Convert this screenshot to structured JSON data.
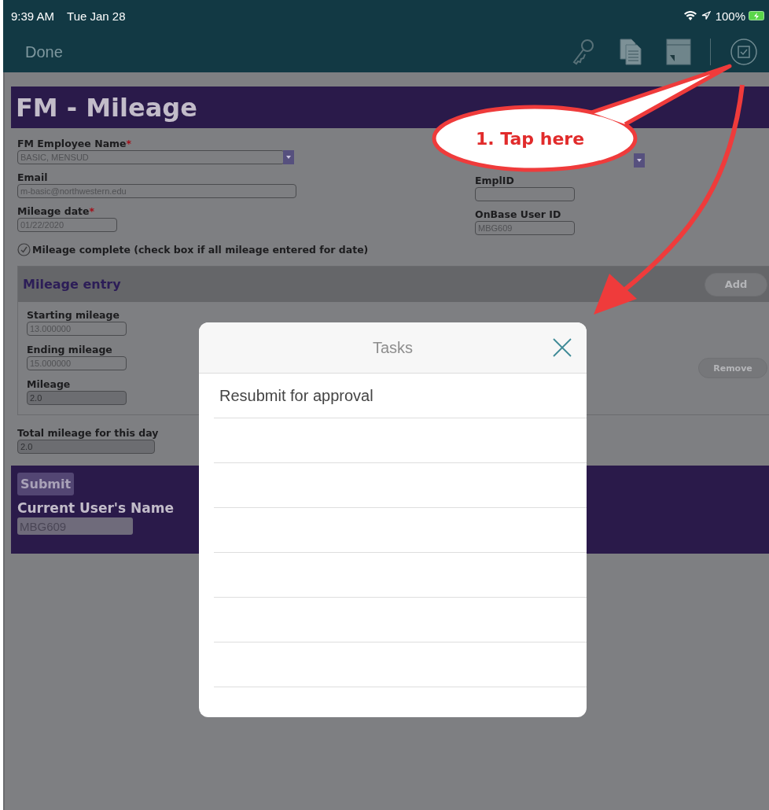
{
  "status_bar": {
    "time": "9:39 AM",
    "date": "Tue Jan 28",
    "battery": "100%"
  },
  "nav_bar": {
    "done": "Done"
  },
  "form": {
    "title": "FM - Mileage",
    "fields_left": [
      {
        "kind": "select",
        "label": "FM Employee Name",
        "required_mark": "*",
        "value": "BASIC, MENSUD",
        "readonly": false
      },
      {
        "kind": "text",
        "label": "Email",
        "value": "m-basic@northwestern.edu",
        "readonly": false
      },
      {
        "kind": "text",
        "label": "Mileage date",
        "required_mark": "*",
        "value": "01/22/2020",
        "readonly": false
      }
    ],
    "fields_right": [
      {
        "kind": "select_stub"
      },
      {
        "kind": "text",
        "label": "EmplID",
        "readonly": false
      },
      {
        "kind": "text",
        "label": "OnBase User ID",
        "value": "MBG609",
        "readonly": false
      }
    ],
    "checkbox": {
      "label": "Mileage complete (check box if all mileage entered for date)",
      "checked": true
    },
    "mileage_entry": {
      "title": "Mileage entry",
      "add_button": "Add",
      "remove_button": "Remove",
      "fields": [
        {
          "label": "Starting mileage",
          "value": "13.000000",
          "readonly": false
        },
        {
          "label": "Ending mileage",
          "value": "15.000000",
          "readonly": false
        },
        {
          "label": "Mileage",
          "value": "2.0",
          "readonly": true
        }
      ]
    },
    "total": {
      "label": "Total mileage for this day",
      "value": "2.0",
      "readonly": true
    },
    "submit_button": "Submit",
    "current_user": {
      "label": "Current User's Name",
      "value": "MBG609"
    }
  },
  "dialog": {
    "title": "Tasks",
    "items": [
      "Resubmit for approval"
    ]
  },
  "annotation": {
    "text": "1. Tap here"
  }
}
